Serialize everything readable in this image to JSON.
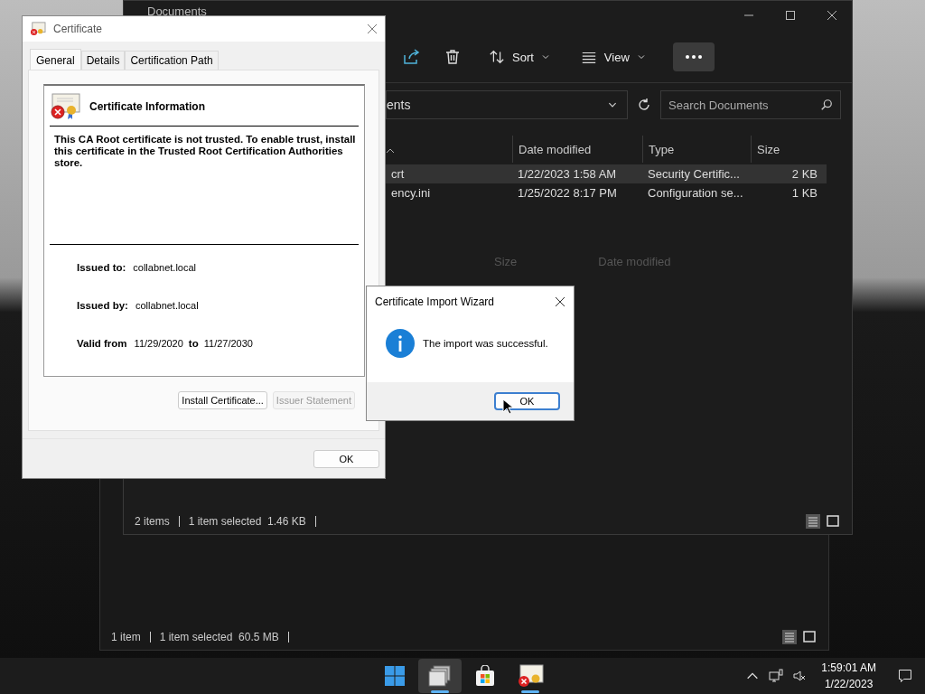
{
  "back_explorer": {
    "columns": [
      "Size",
      "Date modified"
    ],
    "status": [
      "1 item",
      "1 item selected  60.5 MB"
    ]
  },
  "explorer": {
    "title": "Documents",
    "toolbar": [
      {
        "kind": "share"
      },
      {
        "kind": "delete"
      },
      {
        "kind": "menu",
        "label": "Sort"
      },
      {
        "kind": "menu",
        "label": "View"
      },
      {
        "kind": "more"
      }
    ],
    "address": "ents",
    "search": {
      "placeholder": "Search Documents"
    },
    "columns": [
      "Date modified",
      "Type",
      "Size"
    ],
    "rows": [
      {
        "name": "crt",
        "date": "1/22/2023 1:58 AM",
        "type": "Security Certific...",
        "size": "2 KB",
        "selected": true
      },
      {
        "name": "ency.ini",
        "date": "1/25/2022 8:17 PM",
        "type": "Configuration se...",
        "size": "1 KB",
        "selected": false
      }
    ],
    "status": [
      "2 items",
      "1 item selected  1.46 KB"
    ]
  },
  "certificate_dialog": {
    "title": "Certificate",
    "tabs": [
      {
        "label": "General",
        "selected": true
      },
      {
        "label": "Details",
        "selected": false
      },
      {
        "label": "Certification Path",
        "selected": false
      }
    ],
    "heading": "Certificate Information",
    "message": "This CA Root certificate is not trusted. To enable trust, install this certificate in the Trusted Root Certification Authorities store.",
    "fields": [
      {
        "label": "Issued to:",
        "value": "collabnet.local"
      },
      {
        "label": "Issued by:",
        "value": "collabnet.local"
      }
    ],
    "validity": {
      "label": "Valid from",
      "from": "11/29/2020",
      "separator": "to",
      "to": "11/27/2030"
    },
    "buttons": [
      {
        "label": "Install Certificate...",
        "disabled": false
      },
      {
        "label": "Issuer Statement",
        "disabled": true
      }
    ],
    "ok": "OK"
  },
  "wizard": {
    "title": "Certificate Import Wizard",
    "message": "The import was successful.",
    "button": "OK"
  },
  "taskbar": {
    "apps": [
      {
        "kind": "start",
        "selected": false,
        "running": false
      },
      {
        "kind": "files",
        "selected": true,
        "running": true
      },
      {
        "kind": "store",
        "selected": false,
        "running": false
      },
      {
        "kind": "certificate",
        "selected": false,
        "running": true
      }
    ],
    "time": "1:59:01 AM",
    "date": "1/22/2023"
  }
}
